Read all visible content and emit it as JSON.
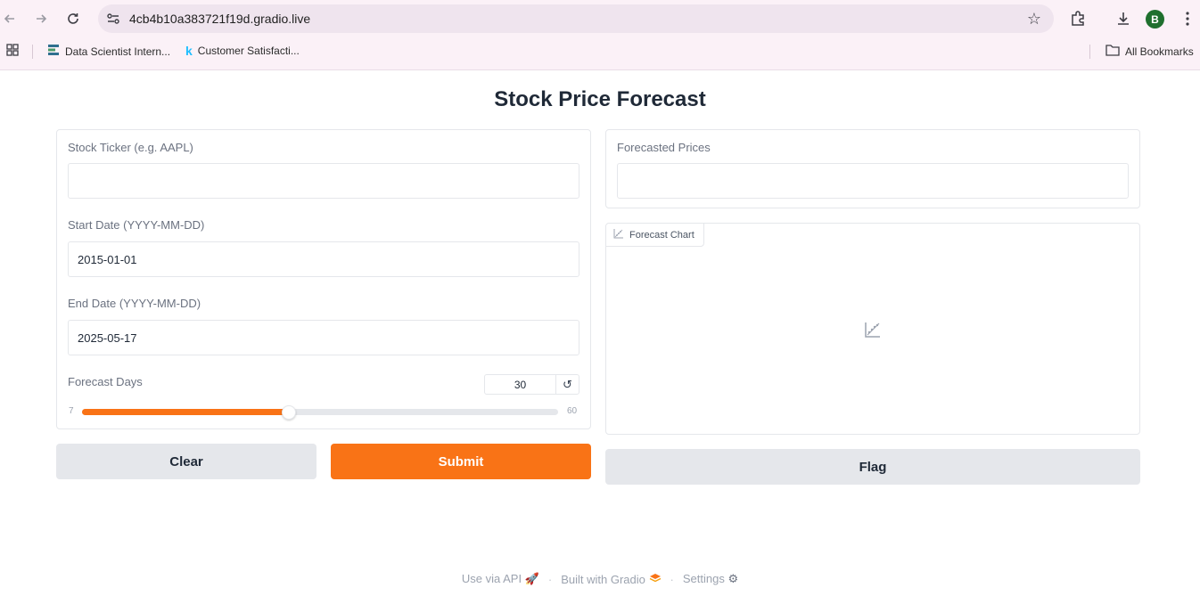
{
  "browser": {
    "url": "4cb4b10a383721f19d.gradio.live",
    "avatar_initial": "B",
    "bookmarks": [
      {
        "label": "Data Scientist Intern..."
      },
      {
        "label": "Customer Satisfacti..."
      }
    ],
    "all_bookmarks_label": "All Bookmarks"
  },
  "page": {
    "title": "Stock Price Forecast"
  },
  "inputs": {
    "ticker": {
      "label": "Stock Ticker (e.g. AAPL)",
      "value": ""
    },
    "start_date": {
      "label": "Start Date (YYYY-MM-DD)",
      "value": "2015-01-01"
    },
    "end_date": {
      "label": "End Date (YYYY-MM-DD)",
      "value": "2025-05-17"
    },
    "forecast_days": {
      "label": "Forecast Days",
      "value": "30",
      "min": "7",
      "max": "60",
      "fraction": 0.434
    }
  },
  "buttons": {
    "clear": "Clear",
    "submit": "Submit",
    "flag": "Flag"
  },
  "outputs": {
    "forecasted_prices": {
      "label": "Forecasted Prices",
      "value": ""
    },
    "forecast_chart": {
      "label": "Forecast Chart"
    }
  },
  "footer": {
    "api": "Use via API",
    "built": "Built with Gradio",
    "settings": "Settings"
  },
  "colors": {
    "accent": "#f97316",
    "secondary_button": "#e5e7eb",
    "text": "#1f2937",
    "muted": "#6b7280"
  }
}
